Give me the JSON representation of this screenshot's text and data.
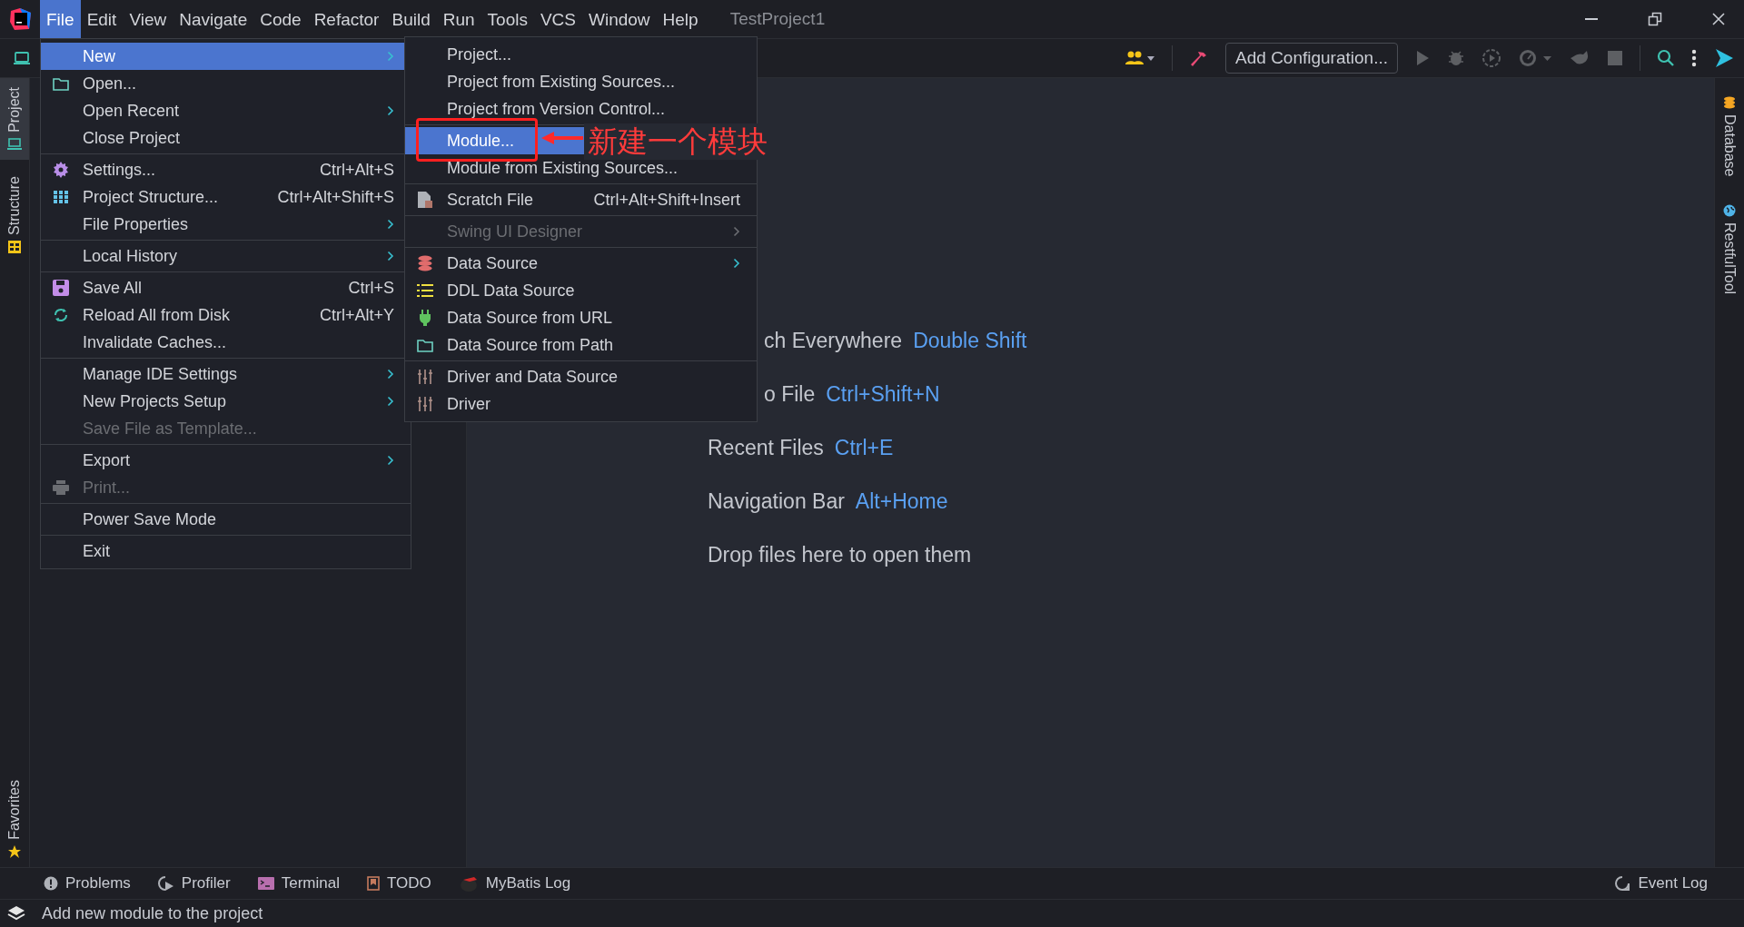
{
  "menu_bar": {
    "items": [
      {
        "label": "File",
        "selected": true
      },
      {
        "label": "Edit",
        "selected": false
      },
      {
        "label": "View",
        "selected": false
      },
      {
        "label": "Navigate",
        "selected": false
      },
      {
        "label": "Code",
        "selected": false
      },
      {
        "label": "Refactor",
        "selected": false
      },
      {
        "label": "Build",
        "selected": false
      },
      {
        "label": "Run",
        "selected": false
      },
      {
        "label": "Tools",
        "selected": false
      },
      {
        "label": "VCS",
        "selected": false
      },
      {
        "label": "Window",
        "selected": false
      },
      {
        "label": "Help",
        "selected": false
      }
    ],
    "project_title": "TestProject1"
  },
  "toolbar": {
    "configuration_button": "Add Configuration..."
  },
  "left_tool_tabs": [
    {
      "label": "Project",
      "selected": true
    },
    {
      "label": "Structure",
      "selected": false
    }
  ],
  "left_bottom_tabs": [
    {
      "label": "Favorites",
      "selected": false
    }
  ],
  "right_tool_tabs": [
    {
      "label": "Database"
    },
    {
      "label": "RestfulTool"
    }
  ],
  "file_menu": {
    "items": [
      {
        "kind": "item",
        "label": "New",
        "submenu": true,
        "selected": true,
        "disabled": false
      },
      {
        "kind": "item",
        "label": "Open...",
        "submenu": false,
        "selected": false,
        "disabled": false
      },
      {
        "kind": "item",
        "label": "Open Recent",
        "submenu": true,
        "selected": false,
        "disabled": false
      },
      {
        "kind": "item",
        "label": "Close Project",
        "submenu": false,
        "selected": false,
        "disabled": false
      },
      {
        "kind": "separator"
      },
      {
        "kind": "item",
        "label": "Settings...",
        "shortcut": "Ctrl+Alt+S",
        "submenu": false,
        "selected": false,
        "disabled": false
      },
      {
        "kind": "item",
        "label": "Project Structure...",
        "shortcut": "Ctrl+Alt+Shift+S",
        "submenu": false,
        "selected": false,
        "disabled": false
      },
      {
        "kind": "item",
        "label": "File Properties",
        "submenu": true,
        "selected": false,
        "disabled": false
      },
      {
        "kind": "separator"
      },
      {
        "kind": "item",
        "label": "Local History",
        "submenu": true,
        "selected": false,
        "disabled": false
      },
      {
        "kind": "separator"
      },
      {
        "kind": "item",
        "label": "Save All",
        "shortcut": "Ctrl+S",
        "submenu": false,
        "selected": false,
        "disabled": false
      },
      {
        "kind": "item",
        "label": "Reload All from Disk",
        "shortcut": "Ctrl+Alt+Y",
        "submenu": false,
        "selected": false,
        "disabled": false
      },
      {
        "kind": "item",
        "label": "Invalidate Caches...",
        "submenu": false,
        "selected": false,
        "disabled": false
      },
      {
        "kind": "separator"
      },
      {
        "kind": "item",
        "label": "Manage IDE Settings",
        "submenu": true,
        "selected": false,
        "disabled": false
      },
      {
        "kind": "item",
        "label": "New Projects Setup",
        "submenu": true,
        "selected": false,
        "disabled": false
      },
      {
        "kind": "item",
        "label": "Save File as Template...",
        "submenu": false,
        "selected": false,
        "disabled": true
      },
      {
        "kind": "separator"
      },
      {
        "kind": "item",
        "label": "Export",
        "submenu": true,
        "selected": false,
        "disabled": false
      },
      {
        "kind": "item",
        "label": "Print...",
        "submenu": false,
        "selected": false,
        "disabled": true
      },
      {
        "kind": "separator"
      },
      {
        "kind": "item",
        "label": "Power Save Mode",
        "submenu": false,
        "selected": false,
        "disabled": false
      },
      {
        "kind": "separator"
      },
      {
        "kind": "item",
        "label": "Exit",
        "submenu": false,
        "selected": false,
        "disabled": false
      }
    ]
  },
  "new_submenu": {
    "items": [
      {
        "kind": "item",
        "label": "Project...",
        "submenu": false,
        "selected": false,
        "disabled": false
      },
      {
        "kind": "item",
        "label": "Project from Existing Sources...",
        "submenu": false,
        "selected": false,
        "disabled": false
      },
      {
        "kind": "item",
        "label": "Project from Version Control...",
        "submenu": false,
        "selected": false,
        "disabled": false
      },
      {
        "kind": "separator"
      },
      {
        "kind": "item",
        "label": "Module...",
        "submenu": false,
        "selected": true,
        "disabled": false
      },
      {
        "kind": "item",
        "label": "Module from Existing Sources...",
        "submenu": false,
        "selected": false,
        "disabled": false
      },
      {
        "kind": "separator"
      },
      {
        "kind": "item",
        "label": "Scratch File",
        "shortcut": "Ctrl+Alt+Shift+Insert",
        "submenu": false,
        "selected": false,
        "disabled": false
      },
      {
        "kind": "separator"
      },
      {
        "kind": "item",
        "label": "Swing UI Designer",
        "submenu": true,
        "selected": false,
        "disabled": true
      },
      {
        "kind": "separator"
      },
      {
        "kind": "item",
        "label": "Data Source",
        "submenu": true,
        "selected": false,
        "disabled": false
      },
      {
        "kind": "item",
        "label": "DDL Data Source",
        "submenu": false,
        "selected": false,
        "disabled": false
      },
      {
        "kind": "item",
        "label": "Data Source from URL",
        "submenu": false,
        "selected": false,
        "disabled": false
      },
      {
        "kind": "item",
        "label": "Data Source from Path",
        "submenu": false,
        "selected": false,
        "disabled": false
      },
      {
        "kind": "separator"
      },
      {
        "kind": "item",
        "label": "Driver and Data Source",
        "submenu": false,
        "selected": false,
        "disabled": false
      },
      {
        "kind": "item",
        "label": "Driver",
        "submenu": false,
        "selected": false,
        "disabled": false
      }
    ]
  },
  "annotation": {
    "text": "新建一个模块"
  },
  "editor_hints": [
    {
      "kind": "partial",
      "label": "ch Everywhere",
      "shortcut": "Double Shift"
    },
    {
      "kind": "partial",
      "label": "o File",
      "shortcut": "Ctrl+Shift+N"
    },
    {
      "kind": "full",
      "label": "Recent Files",
      "shortcut": "Ctrl+E"
    },
    {
      "kind": "full",
      "label": "Navigation Bar",
      "shortcut": "Alt+Home"
    },
    {
      "kind": "full",
      "label": "Drop files here to open them"
    }
  ],
  "bottom_tool_tabs": [
    {
      "label": "Problems"
    },
    {
      "label": "Profiler"
    },
    {
      "label": "Terminal"
    },
    {
      "label": "TODO"
    },
    {
      "label": "MyBatis Log"
    }
  ],
  "event_log": "Event Log",
  "status_bar": {
    "message": "Add new module to the project"
  }
}
